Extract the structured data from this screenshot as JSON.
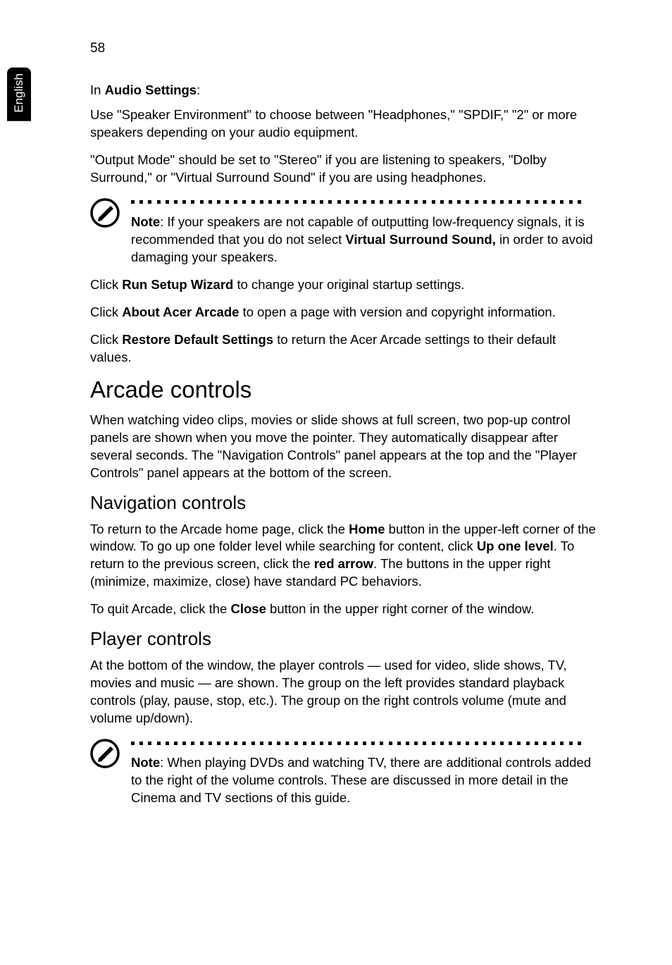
{
  "page_number": "58",
  "side_label": "English",
  "audio_settings_label": "Audio Settings",
  "in_prefix": "In ",
  "colon": ":",
  "para_speaker_env": "Use \"Speaker Environment\" to choose between \"Headphones,\" \"SPDIF,\" \"2\" or more speakers depending on your audio equipment.",
  "para_output_mode": "\"Output Mode\" should be set to \"Stereo\" if you are listening to speakers, \"Dolby Surround,\" or \"Virtual Surround Sound\" if you are using headphones.",
  "note1": {
    "note_label": "Note",
    "text_a": ": If your speakers are not capable of outputting low-frequency signals, it is recommended that you do not select ",
    "vss_bold": "Virtual Surround Sound,",
    "text_b": " in order to avoid damaging your speakers."
  },
  "click_prefix": "Click ",
  "run_setup_wizard": "Run Setup Wizard",
  "run_setup_tail": " to change your original startup settings.",
  "about_acer_arcade": "About Acer Arcade",
  "about_tail": " to open a page with version and copyright information.",
  "restore_default": "Restore Default Settings",
  "restore_tail": " to return the Acer Arcade settings to their default values.",
  "h1_arcade_controls": "Arcade controls",
  "para_arcade_controls": "When watching video clips, movies or slide shows at full screen, two pop-up control panels are shown when you move the pointer. They automatically disappear after several seconds. The \"Navigation Controls\" panel appears at the top and the \"Player Controls\" panel appears at the bottom of the screen.",
  "h2_nav_controls": "Navigation controls",
  "nav_para_a": "To return to the Arcade home page, click the ",
  "nav_home": "Home",
  "nav_para_b": " button in the upper-left corner of the window. To go up one folder level while searching for content, click ",
  "nav_up_one": "Up one level",
  "nav_para_c": ". To return to the previous screen, click the ",
  "nav_red_arrow": "red arrow",
  "nav_para_d": ". The buttons in the upper right (minimize, maximize, close) have standard PC behaviors.",
  "quit_a": "To quit Arcade, click the ",
  "quit_close": "Close",
  "quit_b": " button in the upper right corner of the window.",
  "h2_player_controls": "Player controls",
  "player_para": "At the bottom of the window, the player controls — used for video, slide shows, TV, movies and music — are shown. The group on the left provides standard playback controls (play, pause, stop, etc.). The group on the right controls volume (mute and volume up/down).",
  "note2": {
    "note_label": "Note",
    "text": ": When playing DVDs and watching TV, there are additional controls added to the right of the volume controls. These are discussed in more detail in the Cinema and TV sections of this guide."
  }
}
